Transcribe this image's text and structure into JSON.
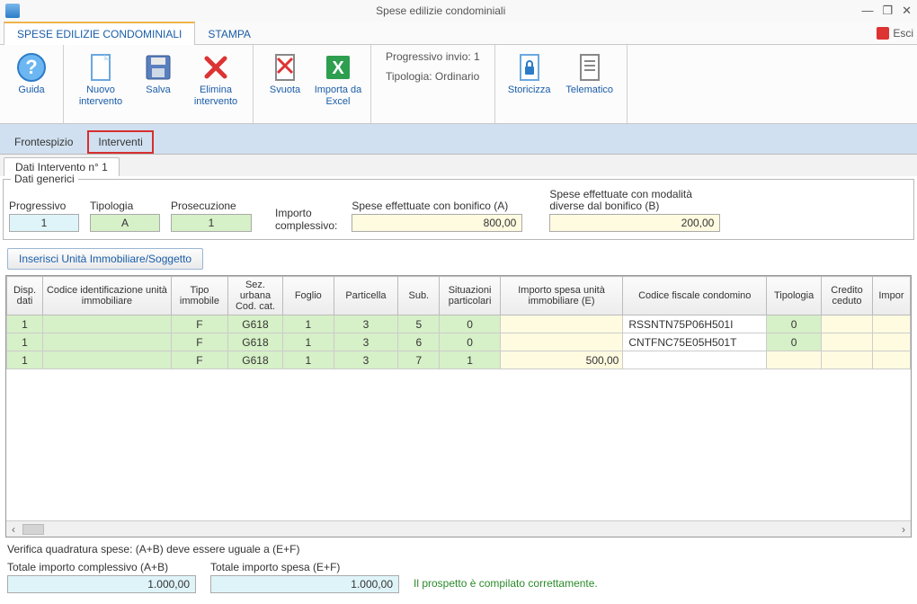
{
  "window": {
    "title": "Spese edilizie condominiali",
    "minimize": "—",
    "restore": "❐",
    "close": "✕",
    "esci_label": "Esci"
  },
  "menu": {
    "items": [
      "SPESE EDILIZIE CONDOMINIALI",
      "STAMPA"
    ],
    "active": 0
  },
  "ribbon": {
    "guida": "Guida",
    "nuovo": "Nuovo intervento",
    "salva": "Salva",
    "elimina": "Elimina intervento",
    "svuota": "Svuota",
    "importa": "Importa da Excel",
    "progressivo": "Progressivo invio: 1",
    "tipologia": "Tipologia: Ordinario",
    "storicizza": "Storicizza",
    "telematico": "Telematico"
  },
  "subtabs": {
    "frontespizio": "Frontespizio",
    "interventi": "Interventi"
  },
  "nested": {
    "dati_intervento": "Dati Intervento n° 1"
  },
  "dati_generici": {
    "title": "Dati generici",
    "progressivo_label": "Progressivo",
    "progressivo_value": "1",
    "tipologia_label": "Tipologia",
    "tipologia_value": "A",
    "prosecuzione_label": "Prosecuzione",
    "prosecuzione_value": "1",
    "importo_label1": "Importo",
    "importo_label2": "complessivo:",
    "spese_bonifico_label": "Spese effettuate con bonifico (A)",
    "spese_bonifico_value": "800,00",
    "spese_diverse_label1": "Spese effettuate con modalità",
    "spese_diverse_label2": "diverse dal bonifico (B)",
    "spese_diverse_value": "200,00"
  },
  "insert_button": "Inserisci Unità Immobiliare/Soggetto",
  "table": {
    "headers": [
      "Disp. dati",
      "Codice identificazione unità immobiliare",
      "Tipo immobile",
      "Sez. urbana Cod. cat.",
      "Foglio",
      "Particella",
      "Sub.",
      "Situazioni particolari",
      "Importo spesa unità immobiliare (E)",
      "Codice fiscale condomino",
      "Tipologia",
      "Credito ceduto",
      "Impor"
    ],
    "rows": [
      {
        "disp": "1",
        "codice_uid": "",
        "tipo": "F",
        "sez": "G618",
        "foglio": "1",
        "part": "3",
        "sub": "5",
        "sit": "0",
        "importo": "",
        "cf": "RSSNTN75P06H501I",
        "tip": "0",
        "credito": "",
        "impor": ""
      },
      {
        "disp": "1",
        "codice_uid": "",
        "tipo": "F",
        "sez": "G618",
        "foglio": "1",
        "part": "3",
        "sub": "6",
        "sit": "0",
        "importo": "",
        "cf": "CNTFNC75E05H501T",
        "tip": "0",
        "credito": "",
        "impor": ""
      },
      {
        "disp": "1",
        "codice_uid": "",
        "tipo": "F",
        "sez": "G618",
        "foglio": "1",
        "part": "3",
        "sub": "7",
        "sit": "1",
        "importo": "500,00",
        "cf": "",
        "tip": "",
        "credito": "",
        "impor": ""
      }
    ]
  },
  "footer": {
    "verifica": "Verifica quadratura spese: (A+B) deve essere uguale a (E+F)",
    "tot_ab_label": "Totale importo complessivo (A+B)",
    "tot_ab_value": "1.000,00",
    "tot_ef_label": "Totale importo spesa (E+F)",
    "tot_ef_value": "1.000,00",
    "ok": "Il prospetto è compilato correttamente."
  }
}
